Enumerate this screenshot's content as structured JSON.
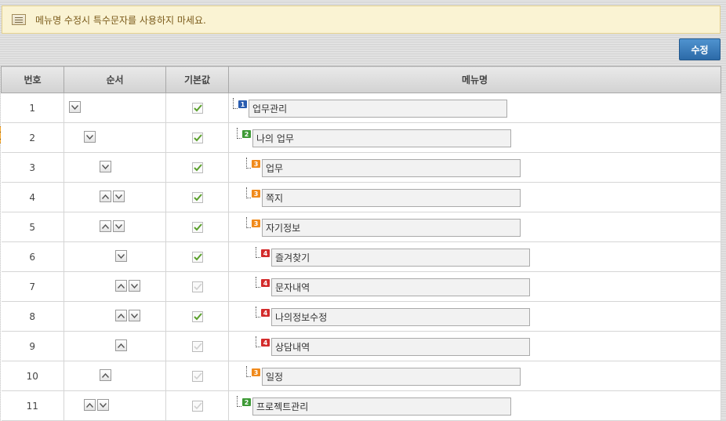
{
  "notice": {
    "text": "메뉴명 수정시 특수문자를 사용하지 마세요."
  },
  "toolbar": {
    "save_label": "수정"
  },
  "columns": [
    "번호",
    "순서",
    "기본값",
    "메뉴명"
  ],
  "rows": [
    {
      "num": "1",
      "name": "업무관리",
      "level": 1,
      "level_label": "1",
      "arrows": [
        "down"
      ],
      "default_checked": true
    },
    {
      "num": "2",
      "name": "나의 업무",
      "level": 2,
      "level_label": "2",
      "arrows": [
        "down"
      ],
      "default_checked": true
    },
    {
      "num": "3",
      "name": "업무",
      "level": 3,
      "level_label": "3",
      "arrows": [
        "down"
      ],
      "default_checked": true
    },
    {
      "num": "4",
      "name": "쪽지",
      "level": 3,
      "level_label": "3",
      "arrows": [
        "up",
        "down"
      ],
      "default_checked": true
    },
    {
      "num": "5",
      "name": "자기정보",
      "level": 3,
      "level_label": "3",
      "arrows": [
        "up",
        "down"
      ],
      "default_checked": true
    },
    {
      "num": "6",
      "name": "즐겨찾기",
      "level": 4,
      "level_label": "4",
      "arrows": [
        "down"
      ],
      "default_checked": true
    },
    {
      "num": "7",
      "name": "문자내역",
      "level": 4,
      "level_label": "4",
      "arrows": [
        "up",
        "down"
      ],
      "default_checked": false
    },
    {
      "num": "8",
      "name": "나의정보수정",
      "level": 4,
      "level_label": "4",
      "arrows": [
        "up",
        "down"
      ],
      "default_checked": true
    },
    {
      "num": "9",
      "name": "상담내역",
      "level": 4,
      "level_label": "4",
      "arrows": [
        "up"
      ],
      "default_checked": false
    },
    {
      "num": "10",
      "name": "일정",
      "level": 3,
      "level_label": "3",
      "arrows": [
        "up"
      ],
      "default_checked": false
    },
    {
      "num": "11",
      "name": "프로젝트관리",
      "level": 2,
      "level_label": "2",
      "arrows": [
        "up",
        "down"
      ],
      "default_checked": false
    }
  ],
  "colors": {
    "save_button": "#3a7bbf",
    "level1": "#2a5db0",
    "level2": "#3e9a36",
    "level3": "#f08a1c",
    "level4": "#d32d2d",
    "check": "#5aa02c"
  }
}
